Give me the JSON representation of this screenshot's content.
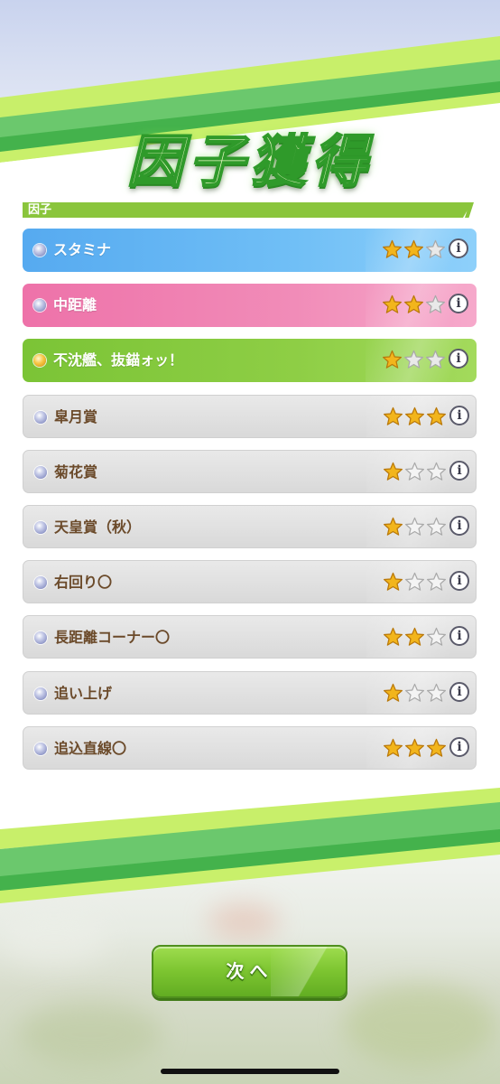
{
  "title": "因子獲得",
  "section_header": "因子",
  "factors": [
    {
      "name": "スタミナ",
      "color": "blue",
      "stars": 2,
      "max_stars": 3,
      "dot": "silver"
    },
    {
      "name": "中距離",
      "color": "pink",
      "stars": 2,
      "max_stars": 3,
      "dot": "silver"
    },
    {
      "name": "不沈艦、抜錨ォッ！",
      "color": "green",
      "stars": 1,
      "max_stars": 3,
      "dot": "gold"
    },
    {
      "name": "皐月賞",
      "color": "grey",
      "stars": 3,
      "max_stars": 3,
      "dot": "silver"
    },
    {
      "name": "菊花賞",
      "color": "grey",
      "stars": 1,
      "max_stars": 3,
      "dot": "silver"
    },
    {
      "name": "天皇賞（秋）",
      "color": "grey",
      "stars": 1,
      "max_stars": 3,
      "dot": "silver"
    },
    {
      "name": "右回り〇",
      "color": "grey",
      "stars": 1,
      "max_stars": 3,
      "dot": "silver"
    },
    {
      "name": "長距離コーナー〇",
      "color": "grey",
      "stars": 2,
      "max_stars": 3,
      "dot": "silver"
    },
    {
      "name": "追い上げ",
      "color": "grey",
      "stars": 1,
      "max_stars": 3,
      "dot": "silver"
    },
    {
      "name": "追込直線〇",
      "color": "grey",
      "stars": 3,
      "max_stars": 3,
      "dot": "silver"
    }
  ],
  "info_icon": "i",
  "next_button": "次へ",
  "colors": {
    "accent_green": "#8ac53c",
    "blue_row": "#56aaf0",
    "pink_row": "#ee72a9",
    "green_row": "#7bc436",
    "grey_row": "#dddddd",
    "label_brown": "#6b4a2a",
    "star_gold": "#f2b51c"
  }
}
